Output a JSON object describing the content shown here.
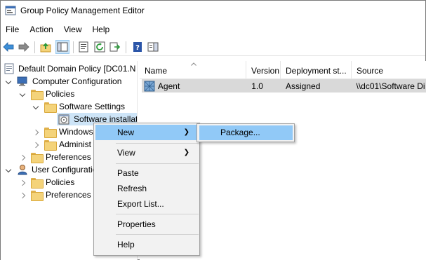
{
  "window": {
    "title": "Group Policy Management Editor"
  },
  "menubar": {
    "items": [
      "File",
      "Action",
      "View",
      "Help"
    ]
  },
  "tree": {
    "root": "Default Domain Policy [DC01.N",
    "computer_config": "Computer Configuration",
    "cc_policies": "Policies",
    "software_settings": "Software Settings",
    "software_installation": "Software installat",
    "windows_settings": "Windows",
    "admin_templates": "Administ",
    "cc_preferences": "Preferences",
    "user_config": "User Configuratio",
    "uc_policies": "Policies",
    "uc_preferences": "Preferences"
  },
  "list": {
    "columns": [
      "Name",
      "Version",
      "Deployment st...",
      "Source"
    ],
    "rows": [
      {
        "name": "Agent",
        "version": "1.0",
        "deployment": "Assigned",
        "source": "\\\\dc01\\Software Di"
      }
    ]
  },
  "context_menu": {
    "new": "New",
    "view": "View",
    "paste": "Paste",
    "refresh": "Refresh",
    "export": "Export List...",
    "properties": "Properties",
    "help": "Help"
  },
  "submenu": {
    "package": "Package..."
  },
  "colors": {
    "highlight": "#91c9f7",
    "row_selected": "#d9d9d9",
    "folder": "#f4d37a"
  }
}
